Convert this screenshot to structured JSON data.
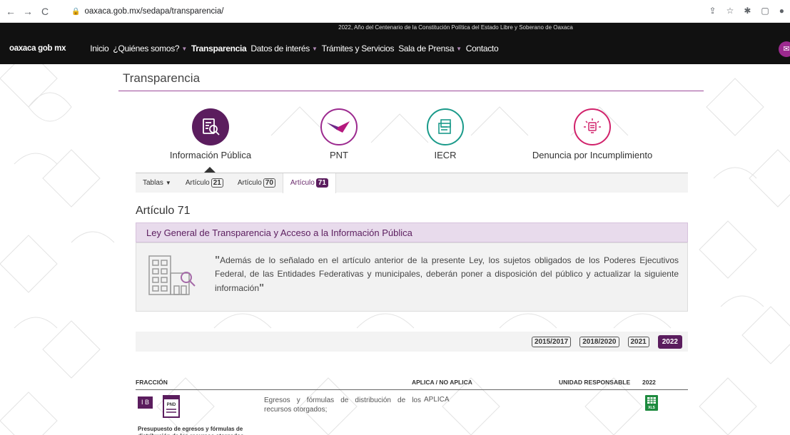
{
  "browser": {
    "url": "oaxaca.gob.mx/sedapa/transparencia/"
  },
  "topbar": {
    "text": "2022, Año del Centenario de la Constitución Política del Estado Libre y Soberano de Oaxaca"
  },
  "navbar": {
    "brand": "oaxaca gob mx",
    "items": [
      {
        "label": "Inicio",
        "caret": false,
        "active": false
      },
      {
        "label": "¿Quiénes somos?",
        "caret": true,
        "active": false
      },
      {
        "label": "Transparencia",
        "caret": false,
        "active": true
      },
      {
        "label": "Datos de interés",
        "caret": true,
        "active": false
      },
      {
        "label": "Trámites y Servicios",
        "caret": false,
        "active": false
      },
      {
        "label": "Sala de Prensa",
        "caret": true,
        "active": false
      },
      {
        "label": "Contacto",
        "caret": false,
        "active": false
      }
    ]
  },
  "page": {
    "title": "Transparencia"
  },
  "sections": [
    {
      "label": "Información Pública",
      "color": "#5b1d5e"
    },
    {
      "label": "PNT",
      "color": "#9c2a8f"
    },
    {
      "label": "IECR",
      "color": "#1a9a8a"
    },
    {
      "label": "Denuncia por Incumplimiento",
      "color": "#d1226b"
    }
  ],
  "subtabs": {
    "tablas": "Tablas",
    "items": [
      {
        "label": "Artículo",
        "num": "21"
      },
      {
        "label": "Artículo",
        "num": "70"
      },
      {
        "label": "Artículo",
        "num": "71"
      }
    ]
  },
  "article": {
    "title": "Artículo 71",
    "law": "Ley General de Transparencia y Acceso a la Información Pública",
    "quote": "Además de lo señalado en el artículo anterior de la presente Ley, los sujetos obligados de los Poderes Ejecutivos Federal, de las Entidades Federativas y municipales, deberán poner a disposición del público y actualizar la siguiente información"
  },
  "years": [
    "2015/2017",
    "2018/2020",
    "2021",
    "2022"
  ],
  "table": {
    "headers": {
      "fraccion": "FRACCIÓN",
      "aplica": "APLICA / NO APLICA",
      "unidad": "UNIDAD RESPONSABLE",
      "year": "2022"
    },
    "row": {
      "badge": "I B",
      "doc_label": "PND",
      "desc": "Egresos y fórmulas de distribución de los recursos otorgados;",
      "aplica": "APLICA",
      "file_label": "XLS",
      "caption": "Presupuesto de egresos y fórmulas de distribución de los recursos otorgados"
    }
  }
}
